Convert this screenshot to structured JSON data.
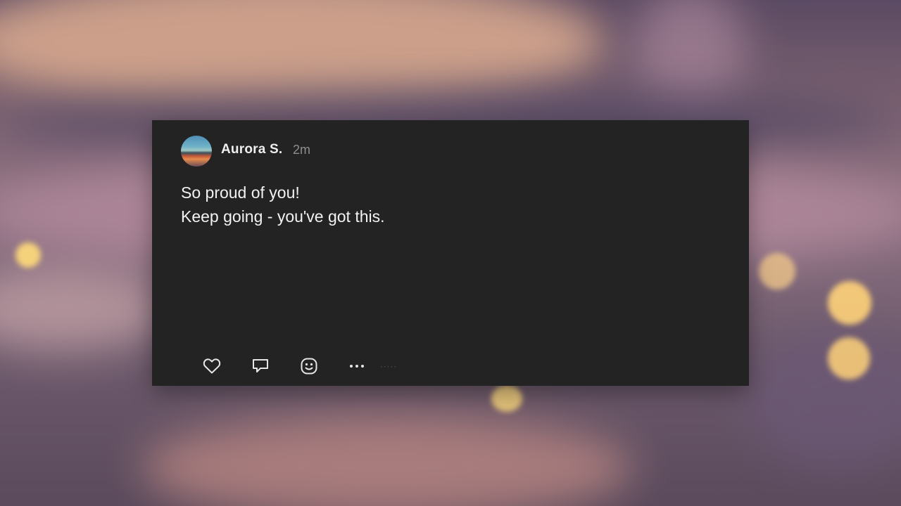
{
  "post": {
    "author": "Aurora S.",
    "time": "2m",
    "message_lines": [
      "So proud of you!",
      "Keep going - you've got this."
    ]
  },
  "actions": [
    {
      "icon": "heart-icon"
    },
    {
      "icon": "comment-icon"
    },
    {
      "icon": "emoji-react-icon"
    },
    {
      "icon": "more-icon"
    }
  ],
  "colors": {
    "card_background": "#232323",
    "text_primary": "#f2f2f2",
    "text_secondary": "#8e8e8e"
  }
}
